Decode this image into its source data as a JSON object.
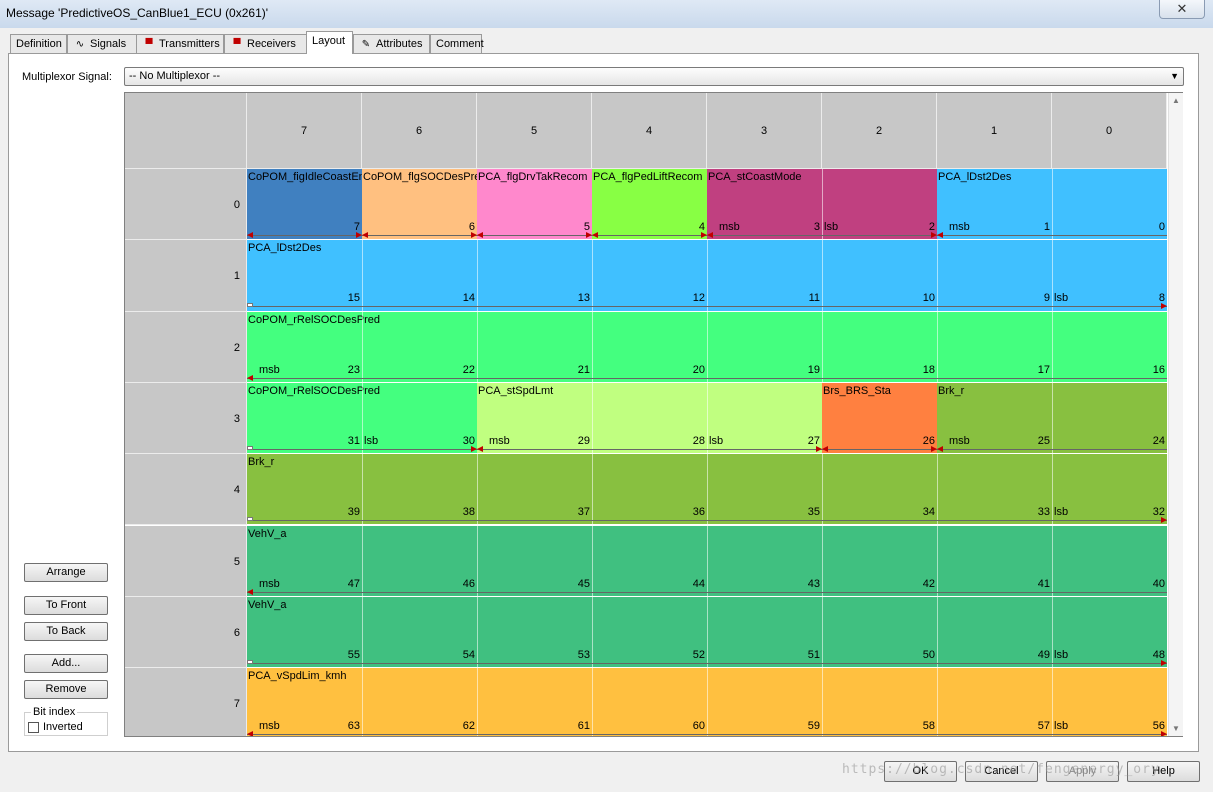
{
  "window": {
    "title": "Message 'PredictiveOS_CanBlue1_ECU (0x261)'",
    "close_glyph": "✕"
  },
  "tabs": [
    {
      "label": "Definition",
      "icon": ""
    },
    {
      "label": "Signals",
      "icon": "signals-icon"
    },
    {
      "label": "Transmitters",
      "icon": "transmitter-icon"
    },
    {
      "label": "Receivers",
      "icon": "receiver-icon"
    },
    {
      "label": "Layout",
      "icon": "",
      "active": true
    },
    {
      "label": "Attributes",
      "icon": "attributes-icon"
    },
    {
      "label": "Comment",
      "icon": ""
    }
  ],
  "multiplexor": {
    "label": "Multiplexor Signal:",
    "value": "-- No Multiplexor --"
  },
  "side_buttons": {
    "arrange": "Arrange",
    "to_front": "To Front",
    "to_back": "To Back",
    "add": "Add...",
    "remove": "Remove"
  },
  "bit_index": {
    "legend": "Bit index",
    "inverted_label": "Inverted",
    "inverted": false
  },
  "grid": {
    "bit_headers": [
      "7",
      "6",
      "5",
      "4",
      "3",
      "2",
      "1",
      "0"
    ],
    "row_headers": [
      "0",
      "1",
      "2",
      "3",
      "4",
      "5",
      "6",
      "7"
    ],
    "colors": {
      "figIdle": "#4080c0",
      "flgSOC": "#ffc080",
      "drvTak": "#ff88cc",
      "pedLift": "#88ff44",
      "coast": "#c04080",
      "dst": "#40c0ff",
      "relSOC": "#44ff7f",
      "spdLmt": "#c0ff80",
      "brs": "#ff8040",
      "brk": "#88c040",
      "vehv": "#40c080",
      "vspd": "#ffc040"
    },
    "rows": [
      {
        "segments": [
          {
            "name": "CoPOM_figIdleCoastEna",
            "color": "figIdle",
            "start": 0,
            "span": 1,
            "bits": [
              "7"
            ],
            "marks": {},
            "arrows": "both"
          },
          {
            "name": "CoPOM_flgSOCDesPred",
            "color": "flgSOC",
            "start": 1,
            "span": 1,
            "bits": [
              "6"
            ],
            "marks": {},
            "arrows": "both"
          },
          {
            "name": "PCA_flgDrvTakRecom",
            "color": "drvTak",
            "start": 2,
            "span": 1,
            "bits": [
              "5"
            ],
            "marks": {},
            "arrows": "both"
          },
          {
            "name": "PCA_flgPedLiftRecom",
            "color": "pedLift",
            "start": 3,
            "span": 1,
            "bits": [
              "4"
            ],
            "marks": {},
            "arrows": "both"
          },
          {
            "name": "PCA_stCoastMode",
            "color": "coast",
            "start": 4,
            "span": 2,
            "bits": [
              "3",
              "2"
            ],
            "marks": {
              "0": "msb",
              "1": "lsb"
            },
            "arrows": "both"
          },
          {
            "name": "PCA_lDst2Des",
            "color": "dst",
            "start": 6,
            "span": 2,
            "bits": [
              "1",
              "0"
            ],
            "marks": {
              "0": "msb"
            },
            "arrows": "left"
          }
        ]
      },
      {
        "segments": [
          {
            "name": "PCA_lDst2Des",
            "color": "dst",
            "start": 0,
            "span": 8,
            "bits": [
              "15",
              "14",
              "13",
              "12",
              "11",
              "10",
              "9",
              "8"
            ],
            "marks": {
              "7": "lsb"
            },
            "arrows": "right"
          }
        ]
      },
      {
        "segments": [
          {
            "name": "CoPOM_rRelSOCDesPred",
            "color": "relSOC",
            "start": 0,
            "span": 8,
            "bits": [
              "23",
              "22",
              "21",
              "20",
              "19",
              "18",
              "17",
              "16"
            ],
            "marks": {
              "0": "msb"
            },
            "arrows": "left"
          }
        ]
      },
      {
        "segments": [
          {
            "name": "CoPOM_rRelSOCDesPred",
            "color": "relSOC",
            "start": 0,
            "span": 2,
            "bits": [
              "31",
              "30"
            ],
            "marks": {
              "1": "lsb"
            },
            "arrows": "right"
          },
          {
            "name": "PCA_stSpdLmt",
            "color": "spdLmt",
            "start": 2,
            "span": 3,
            "bits": [
              "29",
              "28",
              "27"
            ],
            "marks": {
              "0": "msb",
              "2": "lsb"
            },
            "arrows": "both"
          },
          {
            "name": "Brs_BRS_Sta",
            "color": "brs",
            "start": 5,
            "span": 1,
            "bits": [
              "26"
            ],
            "marks": {},
            "arrows": "both"
          },
          {
            "name": "Brk_r",
            "color": "brk",
            "start": 6,
            "span": 2,
            "bits": [
              "25",
              "24"
            ],
            "marks": {
              "0": "msb"
            },
            "arrows": "left"
          }
        ]
      },
      {
        "segments": [
          {
            "name": "Brk_r",
            "color": "brk",
            "start": 0,
            "span": 8,
            "bits": [
              "39",
              "38",
              "37",
              "36",
              "35",
              "34",
              "33",
              "32"
            ],
            "marks": {
              "7": "lsb"
            },
            "arrows": "right"
          }
        ]
      },
      {
        "segments": [
          {
            "name": "VehV_a",
            "color": "vehv",
            "start": 0,
            "span": 8,
            "bits": [
              "47",
              "46",
              "45",
              "44",
              "43",
              "42",
              "41",
              "40"
            ],
            "marks": {
              "0": "msb"
            },
            "arrows": "left"
          }
        ]
      },
      {
        "segments": [
          {
            "name": "VehV_a",
            "color": "vehv",
            "start": 0,
            "span": 8,
            "bits": [
              "55",
              "54",
              "53",
              "52",
              "51",
              "50",
              "49",
              "48"
            ],
            "marks": {
              "7": "lsb"
            },
            "arrows": "right"
          }
        ]
      },
      {
        "segments": [
          {
            "name": "PCA_vSpdLim_kmh",
            "color": "vspd",
            "start": 0,
            "span": 8,
            "bits": [
              "63",
              "62",
              "61",
              "60",
              "59",
              "58",
              "57",
              "56"
            ],
            "marks": {
              "0": "msb",
              "7": "lsb"
            },
            "arrows": "both"
          }
        ]
      }
    ]
  },
  "buttons": {
    "ok": "OK",
    "cancel": "Cancel",
    "apply": "Apply",
    "help": "Help"
  },
  "watermark": "https://blog.csdn.net/fengenergy_ory"
}
